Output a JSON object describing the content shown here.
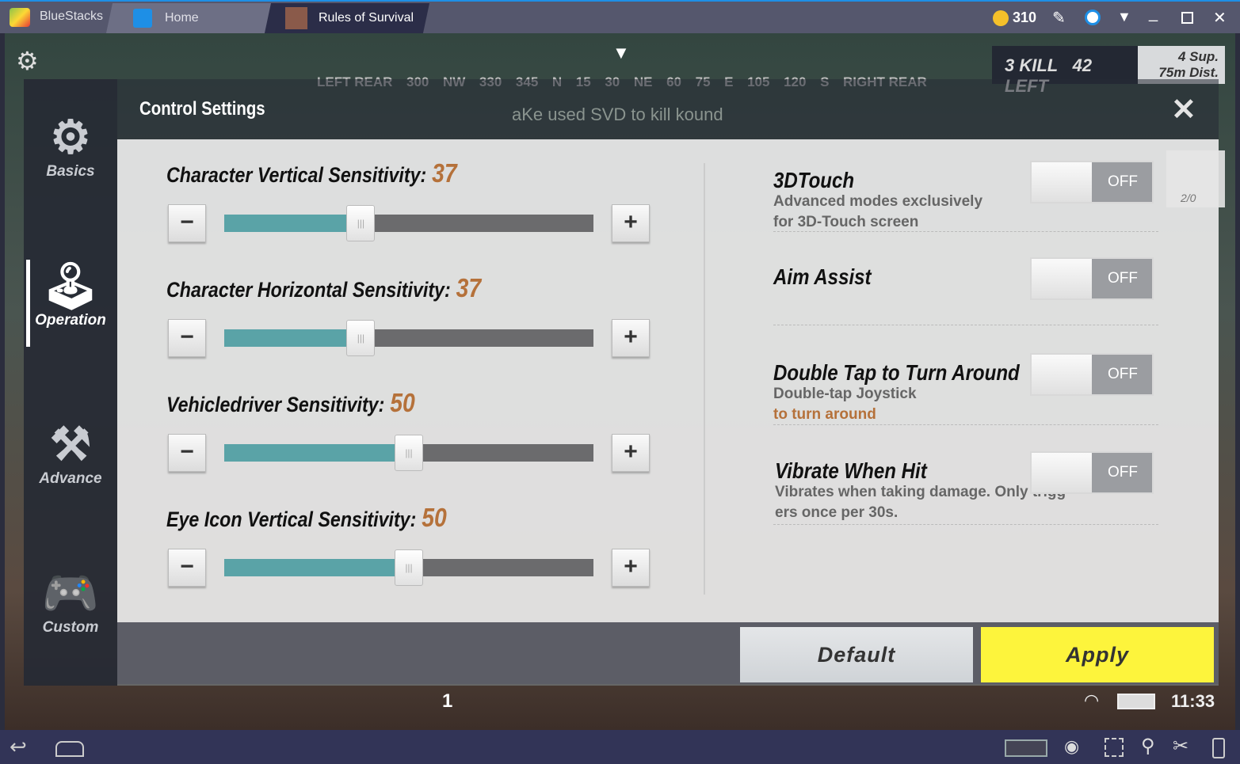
{
  "titlebar": {
    "app": "BlueStacks",
    "tabs": [
      {
        "label": "Home"
      },
      {
        "label": "Rules of Survival"
      }
    ],
    "coins": "310"
  },
  "hud": {
    "compass": [
      "LEFT REAR",
      "300",
      "NW",
      "330",
      "345",
      "N",
      "15",
      "30",
      "NE",
      "60",
      "75",
      "E",
      "105",
      "120",
      "S",
      "RIGHT REAR"
    ],
    "kills": "3 KILL",
    "left": "42 LEFT",
    "supply": "4 Sup.",
    "dist": "75m Dist.",
    "killfeed": "aKe used SVD to kill kound",
    "ammo": "2/0",
    "time": "11:33",
    "count": "1"
  },
  "dialog": {
    "title": "Control Settings"
  },
  "sidebar": {
    "items": [
      {
        "label": "Basics",
        "icon": "gear-icon"
      },
      {
        "label": "Operation",
        "icon": "joystick-icon",
        "active": true
      },
      {
        "label": "Advance",
        "icon": "wrench-gear-icon"
      },
      {
        "label": "Custom",
        "icon": "gamepad-icon"
      }
    ]
  },
  "sliders": [
    {
      "label": "Character Vertical Sensitivity:",
      "value": "37",
      "fraction": 0.37
    },
    {
      "label": "Character Horizontal Sensitivity:",
      "value": "37",
      "fraction": 0.37
    },
    {
      "label": "Vehicledriver Sensitivity:",
      "value": "50",
      "fraction": 0.5
    },
    {
      "label": "Eye Icon Vertical Sensitivity:",
      "value": "50",
      "fraction": 0.5
    }
  ],
  "toggles": [
    {
      "title": "3DTouch",
      "desc1": "Advanced modes exclusively",
      "desc2": "for 3D-Touch screen",
      "state": "OFF"
    },
    {
      "title": "Aim Assist",
      "state": "OFF"
    },
    {
      "title": "Double Tap to Turn Around",
      "desc1": "Double-tap Joystick",
      "desc2": "to turn around",
      "state": "OFF"
    },
    {
      "title": "Vibrate When Hit",
      "desc1": "Vibrates when taking damage. Only trigg",
      "desc2": "ers once per 30s.",
      "state": "OFF"
    }
  ],
  "buttons": {
    "minus": "−",
    "plus": "+",
    "default": "Default",
    "apply": "Apply",
    "close": "✕"
  },
  "colors": {
    "accent": "#b5713a",
    "apply": "#fdf43c",
    "slider_fill": "#5aa3a7"
  }
}
